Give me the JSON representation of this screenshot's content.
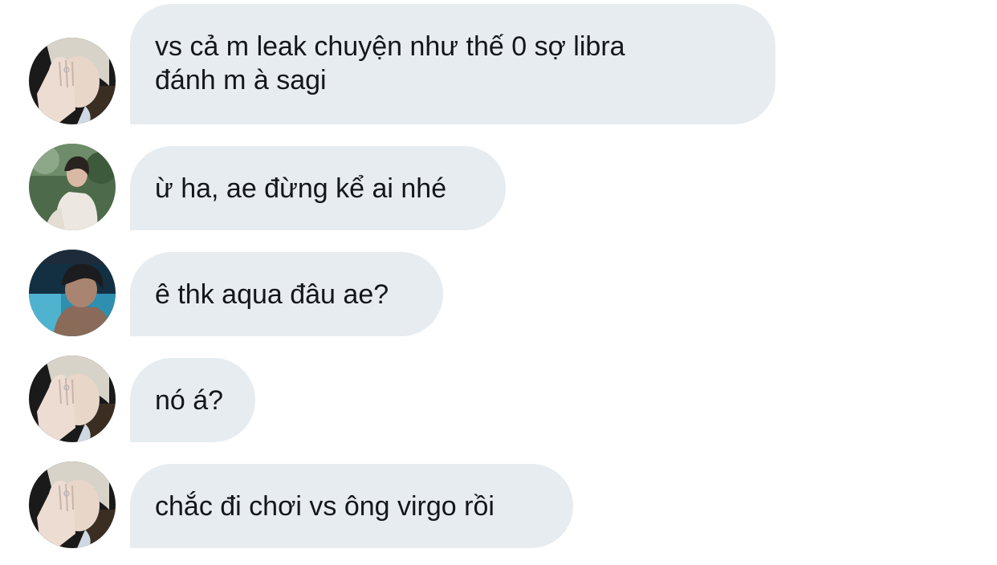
{
  "messages": [
    {
      "avatar": "avatar-blonde-hand-face",
      "lines": [
        "vs cả m leak chuyện như thế 0 sợ libra",
        "đánh m à sagi"
      ]
    },
    {
      "avatar": "avatar-white-shirt-garden",
      "lines": [
        "ừ ha, ae đừng kể ai nhé"
      ]
    },
    {
      "avatar": "avatar-pool-dark-hair",
      "lines": [
        "ê thk aqua đâu ae?"
      ]
    },
    {
      "avatar": "avatar-blonde-hand-face",
      "lines": [
        "nó á?"
      ]
    },
    {
      "avatar": "avatar-blonde-hand-face",
      "lines": [
        "chắc đi chơi vs ông virgo rồi"
      ]
    }
  ],
  "colors": {
    "bubble_bg": "#e7ecf0",
    "text": "#14171a",
    "background": "#ffffff"
  }
}
